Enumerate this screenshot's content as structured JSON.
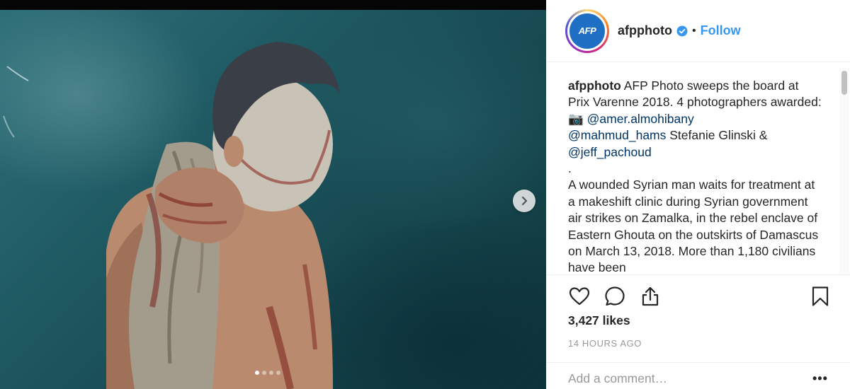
{
  "post": {
    "username": "afpphoto",
    "avatar_text": "AFP",
    "follow_label": "Follow",
    "bullet": "•",
    "verified": true,
    "image_alt": "Wounded Syrian man holding a bloodied towel against a teal background",
    "carousel": {
      "total": 4,
      "current": 1
    }
  },
  "caption": {
    "username": "afpphoto",
    "text_1": " AFP Photo sweeps the board at Prix Varenne 2018. 4 photographers awarded: 📷 ",
    "mention_1": "@amer.almohibany",
    "mention_2": "@mahmud_hams",
    "text_2": " Stefanie Glinski & ",
    "mention_3": "@jeff_pachoud",
    "separator": ".",
    "body": "A wounded Syrian man waits for treatment at a makeshift clinic during Syrian government air strikes on Zamalka, in the rebel enclave of Eastern Ghouta on the outskirts of Damascus on March 13, 2018. More than 1,180 civilians have been"
  },
  "actions": {
    "like_icon": "heart-icon",
    "comment_icon": "comment-icon",
    "share_icon": "share-icon",
    "save_icon": "bookmark-icon"
  },
  "likes": "3,427 likes",
  "timestamp": "14 HOURS AGO",
  "comment": {
    "placeholder": "Add a comment…",
    "more_label": "•••"
  },
  "colors": {
    "link": "#3897f0",
    "mention": "#003569",
    "verified": "#3897f0"
  }
}
